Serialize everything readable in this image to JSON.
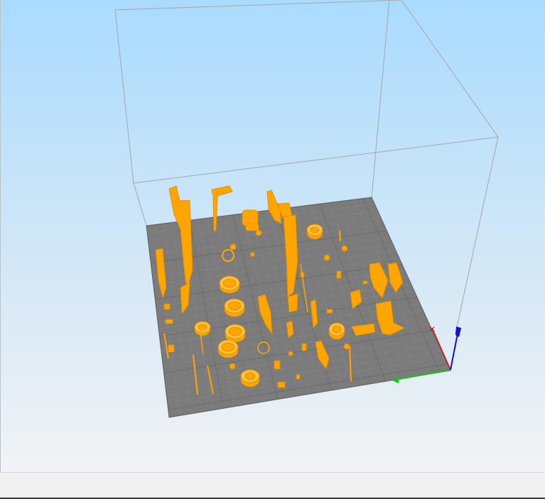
{
  "viewport": {
    "label": "",
    "background_top": "#a9dbff",
    "background_bottom": "#f1f3f5"
  },
  "build_plate": {
    "color": "#7b7b7b",
    "grid_color": "#6a6a6a",
    "grid_minor": "#8a8a8a"
  },
  "build_volume": {
    "line_color": "#a6a6a6"
  },
  "models": {
    "color": "#ffa500",
    "shade": "#e08800",
    "highlight": "#ffc23d"
  },
  "axes": {
    "x": {
      "color": "#e01010"
    },
    "y": {
      "color": "#18c018"
    },
    "z": {
      "color": "#1010e0"
    }
  },
  "statusbar": {
    "text": ""
  }
}
